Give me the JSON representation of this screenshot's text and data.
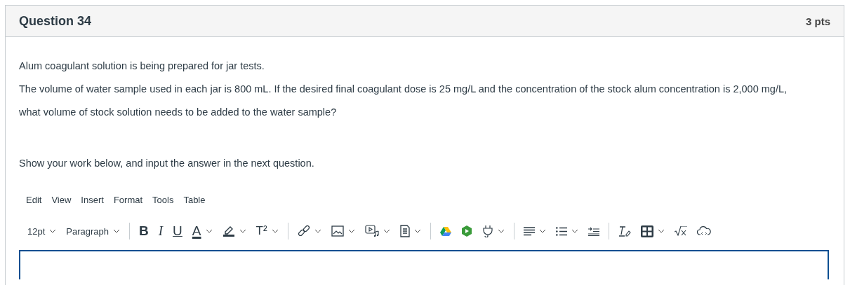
{
  "question": {
    "title": "Question 34",
    "points": "3 pts"
  },
  "paragraphs": [
    "Alum coagulant solution is being prepared for jar tests.",
    "The volume of water sample used in each jar is 800 mL.  If the desired final coagulant dose is 25 mg/L and the concentration of the stock alum concentration is 2,000 mg/L,",
    "what volume of stock solution needs to be added to the water sample?"
  ],
  "instruction": "Show your work below, and input the answer in the next question.",
  "menubar": [
    "Edit",
    "View",
    "Insert",
    "Format",
    "Tools",
    "Table"
  ],
  "toolbar": {
    "font_size": "12pt",
    "block_format": "Paragraph",
    "bold": "B",
    "italic": "I",
    "underline": "U",
    "text_color": "A",
    "superscript": "T²"
  },
  "editor": {
    "focused": true
  }
}
